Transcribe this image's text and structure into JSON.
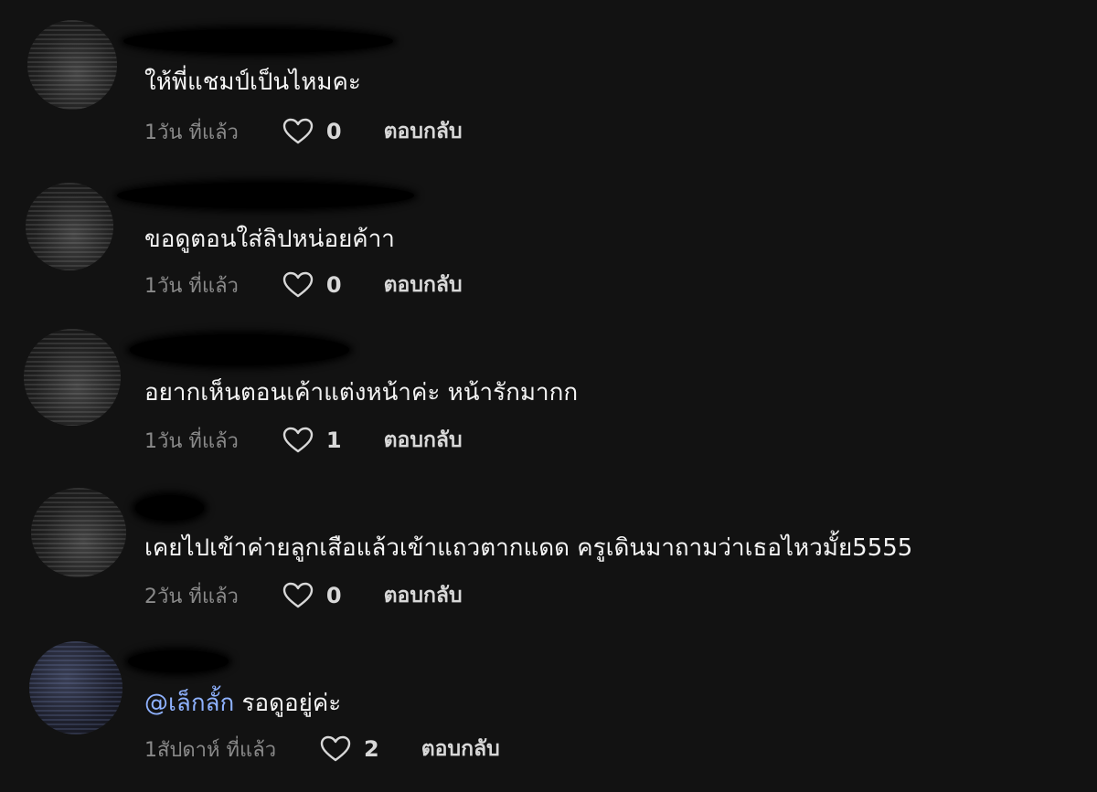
{
  "comments": [
    {
      "text": "ให้พี่แชมป์เป็นไหมคะ",
      "time": "1วัน ที่แล้ว",
      "likes": "0",
      "reply": "ตอบกลับ"
    },
    {
      "text": "ขอดูตอนใส่ลิปหน่อยค้าา",
      "time": "1วัน ที่แล้ว",
      "likes": "0",
      "reply": "ตอบกลับ"
    },
    {
      "text": "อยากเห็นตอนเค้าแต่งหน้าค่ะ หน้ารักมากก",
      "time": "1วัน ที่แล้ว",
      "likes": "1",
      "reply": "ตอบกลับ"
    },
    {
      "text": "เคยไปเข้าค่ายลูกเสือแล้วเข้าแถวตากแดด ครูเดินมาถามว่าเธอไหวมั้ย5555",
      "time": "2วัน ที่แล้ว",
      "likes": "0",
      "reply": "ตอบกลับ"
    },
    {
      "mention": "@เล็กลั้ก",
      "text": " รอดูอยู่ค่ะ",
      "time": "1สัปดาห์ ที่แล้ว",
      "likes": "2",
      "reply": "ตอบกลับ"
    }
  ],
  "colors": {
    "background": "#121212",
    "text": "#f4f4f4",
    "meta": "#8a8a8a",
    "mention": "#8fb2ff"
  },
  "icons": {
    "like": "heart-outline-icon"
  }
}
